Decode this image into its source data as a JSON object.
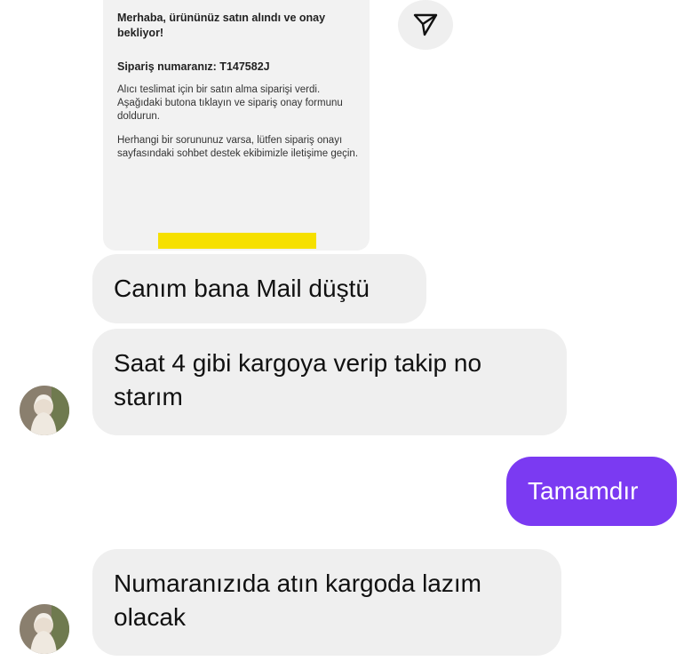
{
  "email": {
    "greeting": "Merhaba, ürününüz satın alındı ve onay bekliyor!",
    "order_line": "Sipariş numaranız: T147582J",
    "paragraph1": "Alıcı teslimat için bir satın alma siparişi verdi. Aşağıdaki butona tıklayın ve sipariş onay formunu doldurun.",
    "paragraph2": "Herhangi bir sorununuz varsa, lütfen sipariş onayı sayfasındaki sohbet destek ekibimizle iletişime geçin.",
    "button_color": "#f6e000"
  },
  "share": {
    "icon": "send-icon"
  },
  "messages": [
    {
      "sender": "other",
      "text": "Canım bana Mail düştü"
    },
    {
      "sender": "other",
      "text": "Saat 4 gibi kargoya verip takip no starım"
    },
    {
      "sender": "me",
      "text": "Tamamdır"
    },
    {
      "sender": "other",
      "text": "Numaranızıda atın kargoda lazım olacak"
    }
  ],
  "colors": {
    "outgoing_bubble": "#7b3af2",
    "incoming_bubble": "#efefef"
  }
}
